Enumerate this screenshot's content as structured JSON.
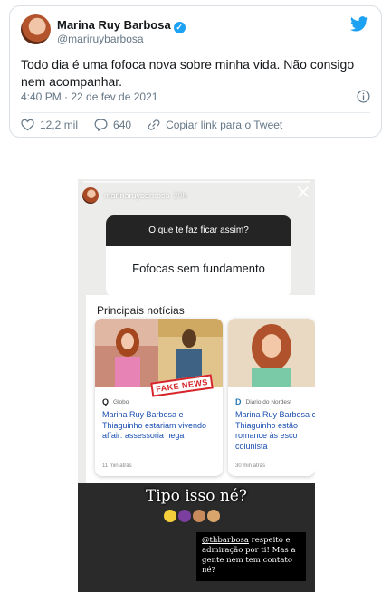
{
  "tweet": {
    "author_name": "Marina Ruy Barbosa",
    "handle": "@mariruybarbosa",
    "text": "Todo dia é uma fofoca nova sobre minha vida. Não consigo nem acompanhar.",
    "timestamp": "4:40 PM · 22 de fev de 2021",
    "likes": "12,2 mil",
    "replies": "640",
    "copy_link_label": "Copiar link para o Tweet",
    "colors": {
      "twitter_blue": "#1da1f2",
      "secondary_text": "#657786"
    }
  },
  "story": {
    "username": "marinaruybarbosa",
    "age": "20h",
    "question": "O que te faz ficar assim?",
    "answer": "Fofocas sem fundamento",
    "news_section_title": "Principais notícias",
    "cards": [
      {
        "source": "Globo",
        "source_logo": "Q",
        "headline": "Marina Ruy Barbosa e Thiaguinho estariam vivendo affair: assessoria nega",
        "time_ago": "11 min atrás",
        "stamp": "FAKE NEWS"
      },
      {
        "source": "Diário do Nordest",
        "source_logo": "D",
        "headline": "Marina Ruy Barbosa e Thiaguinho estão romance às esco colunista",
        "time_ago": "30 min atrás"
      }
    ],
    "caption": "Tipo isso né?",
    "emoji_names": [
      "flushed-face-icon",
      "woman-gesturing-no-icon",
      "woman-facepalming-icon",
      "woman-facepalming-icon"
    ],
    "reply_mention": "@thbarbosa",
    "reply_text": " respeito e admiração por ti! Mas a gente nem tem contato né?"
  }
}
